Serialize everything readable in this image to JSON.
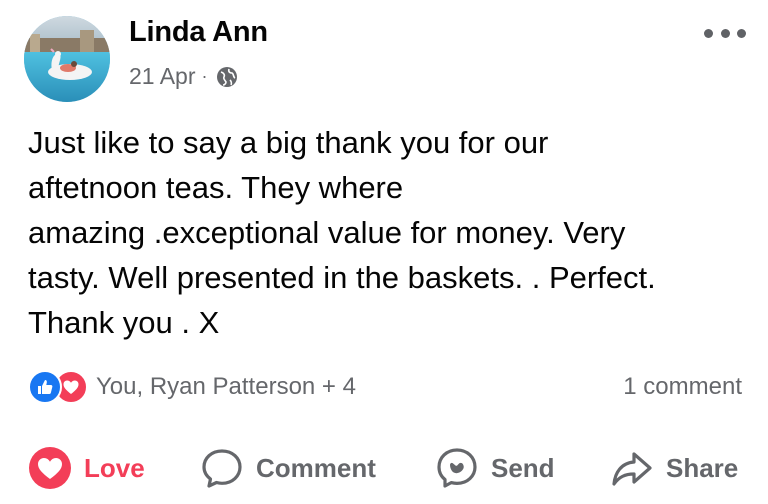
{
  "post": {
    "author": "Linda Ann",
    "date": "21 Apr",
    "separator": "·",
    "privacy_icon": "globe-icon",
    "more_icon": "more-options-icon",
    "text": "Just like to say a big thank you for our\naftetnoon teas.  They where\namazing .exceptional value for money. Very\ntasty.  Well presented in the baskets. . Perfect.\nThank you . X"
  },
  "reactions": {
    "icons": [
      "like-icon",
      "love-icon"
    ],
    "summary": "You, Ryan Patterson + 4",
    "comments": "1 comment"
  },
  "actions": {
    "love": "Love",
    "comment": "Comment",
    "send": "Send",
    "share": "Share"
  },
  "colors": {
    "love": "#f33e58",
    "like": "#1877f2",
    "secondary_text": "#65676b"
  }
}
